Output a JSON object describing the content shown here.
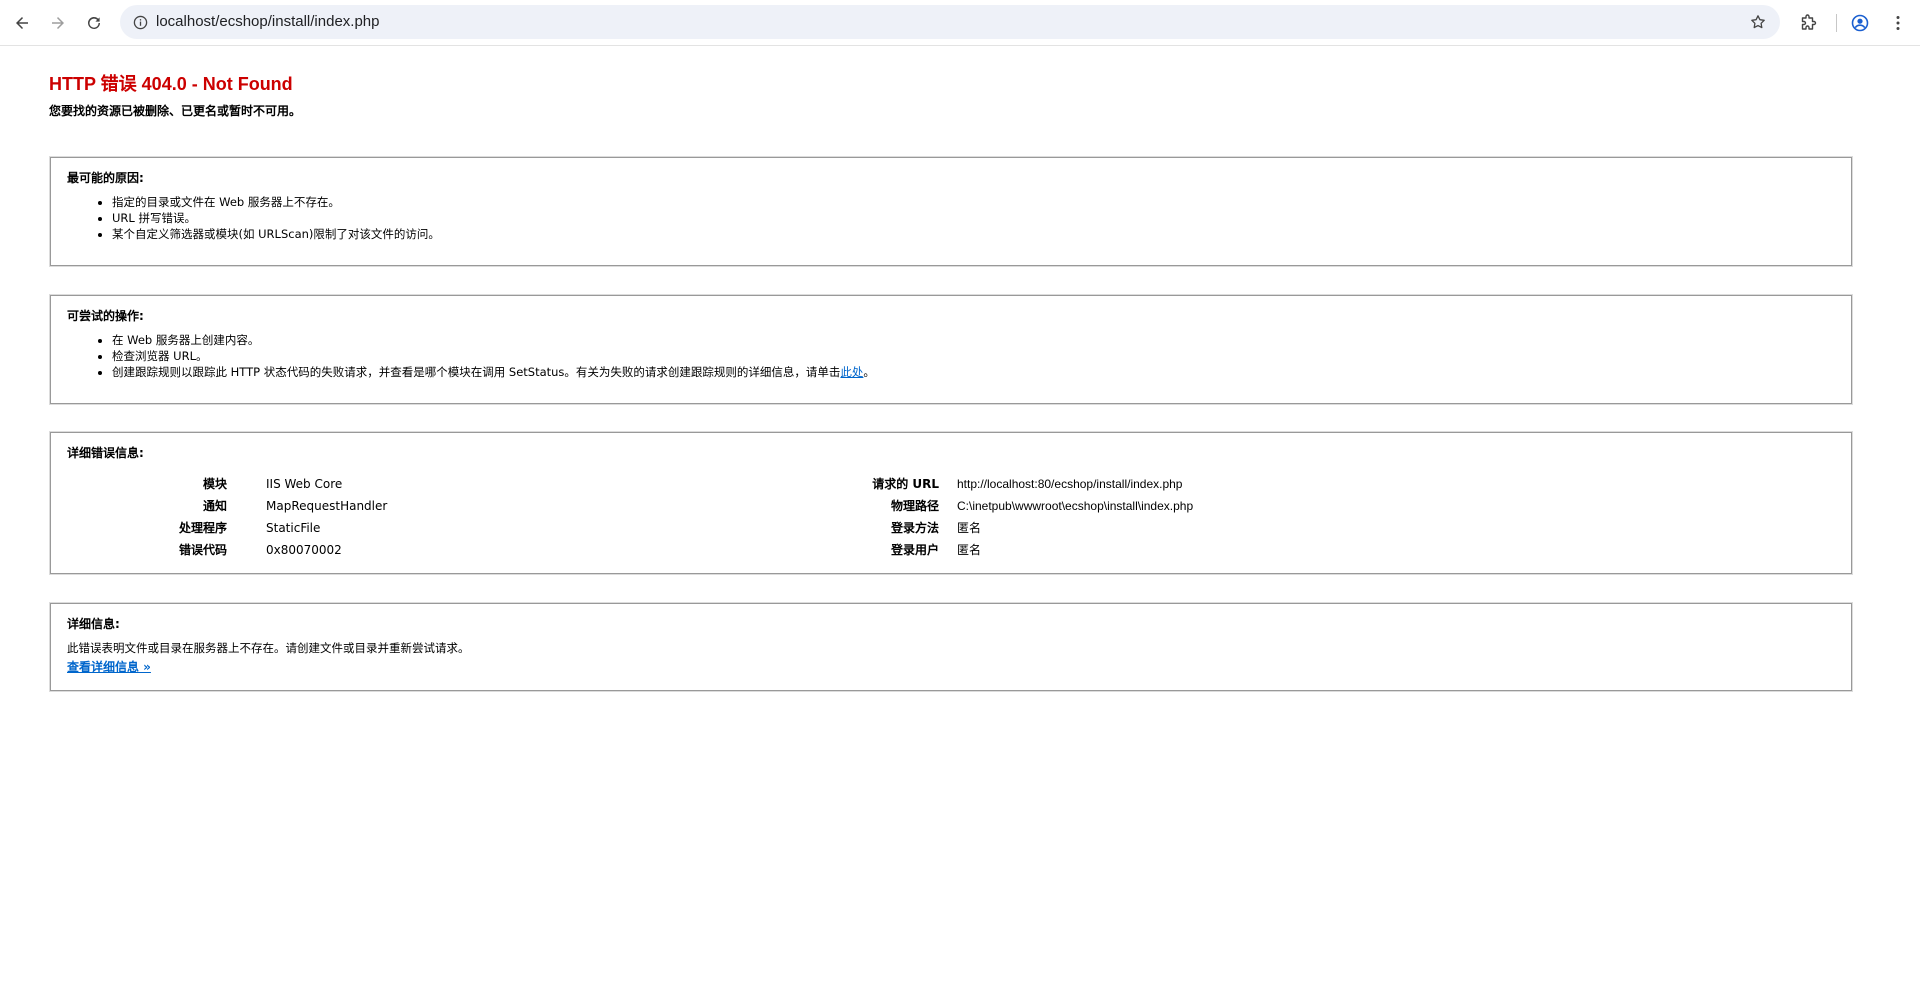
{
  "browser": {
    "url": "localhost/ecshop/install/index.php"
  },
  "page": {
    "title": "HTTP 错误 404.0 - Not Found",
    "subtitle": "您要找的资源已被删除、已更名或暂时不可用。"
  },
  "causes": {
    "heading": "最可能的原因:",
    "items": [
      "指定的目录或文件在 Web 服务器上不存在。",
      "URL 拼写错误。",
      "某个自定义筛选器或模块(如 URLScan)限制了对该文件的访问。"
    ]
  },
  "actions": {
    "heading": "可尝试的操作:",
    "items": [
      "在 Web 服务器上创建内容。",
      "检查浏览器 URL。"
    ],
    "last_item_text": "创建跟踪规则以跟踪此 HTTP 状态代码的失败请求，并查看是哪个模块在调用 SetStatus。有关为失败的请求创建跟踪规则的详细信息，请单击",
    "last_item_link": "此处",
    "last_item_suffix": "。"
  },
  "details": {
    "heading": "详细错误信息:",
    "left": [
      {
        "label": "模块",
        "value": "IIS Web Core"
      },
      {
        "label": "通知",
        "value": "MapRequestHandler"
      },
      {
        "label": "处理程序",
        "value": "StaticFile"
      },
      {
        "label": "错误代码",
        "value": "0x80070002"
      }
    ],
    "right": [
      {
        "label": "请求的 URL",
        "value": "http://localhost:80/ecshop/install/index.php"
      },
      {
        "label": "物理路径",
        "value": "C:\\inetpub\\wwwroot\\ecshop\\install\\index.php"
      },
      {
        "label": "登录方法",
        "value": "匿名"
      },
      {
        "label": "登录用户",
        "value": "匿名"
      }
    ]
  },
  "moreinfo": {
    "heading": "详细信息:",
    "text": "此错误表明文件或目录在服务器上不存在。请创建文件或目录并重新尝试请求。",
    "link": "查看详细信息 »"
  },
  "colors": {
    "error_title": "#cc0000",
    "link": "#0066cc",
    "box_border": "#999999",
    "omnibox_bg": "#eef1f8"
  }
}
